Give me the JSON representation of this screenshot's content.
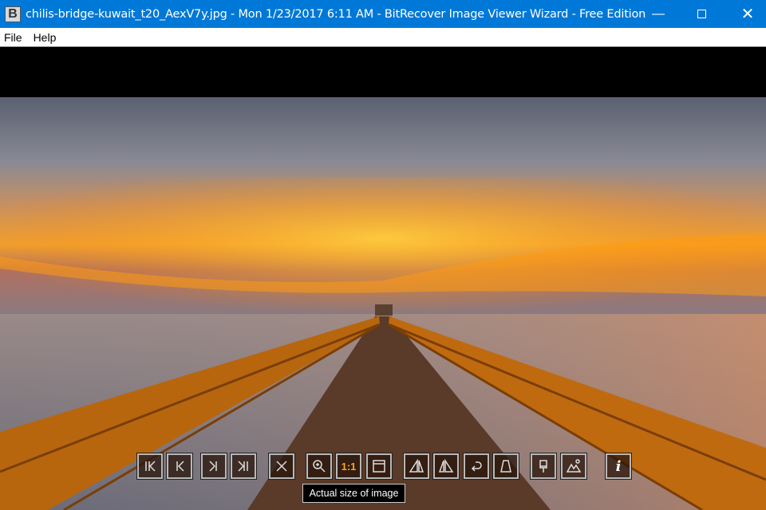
{
  "window": {
    "title": "chilis-bridge-kuwait_t20_AexV7y.jpg - Mon 1/23/2017 6:11 AM - BitRecover Image Viewer Wizard - Free Edition",
    "icon_letter": "B"
  },
  "menu": [
    "File",
    "Help"
  ],
  "toolbar": {
    "actual_size_label": "1:1",
    "info_label": "i",
    "tooltip": "Actual size of image",
    "accent": "#f5a623"
  }
}
